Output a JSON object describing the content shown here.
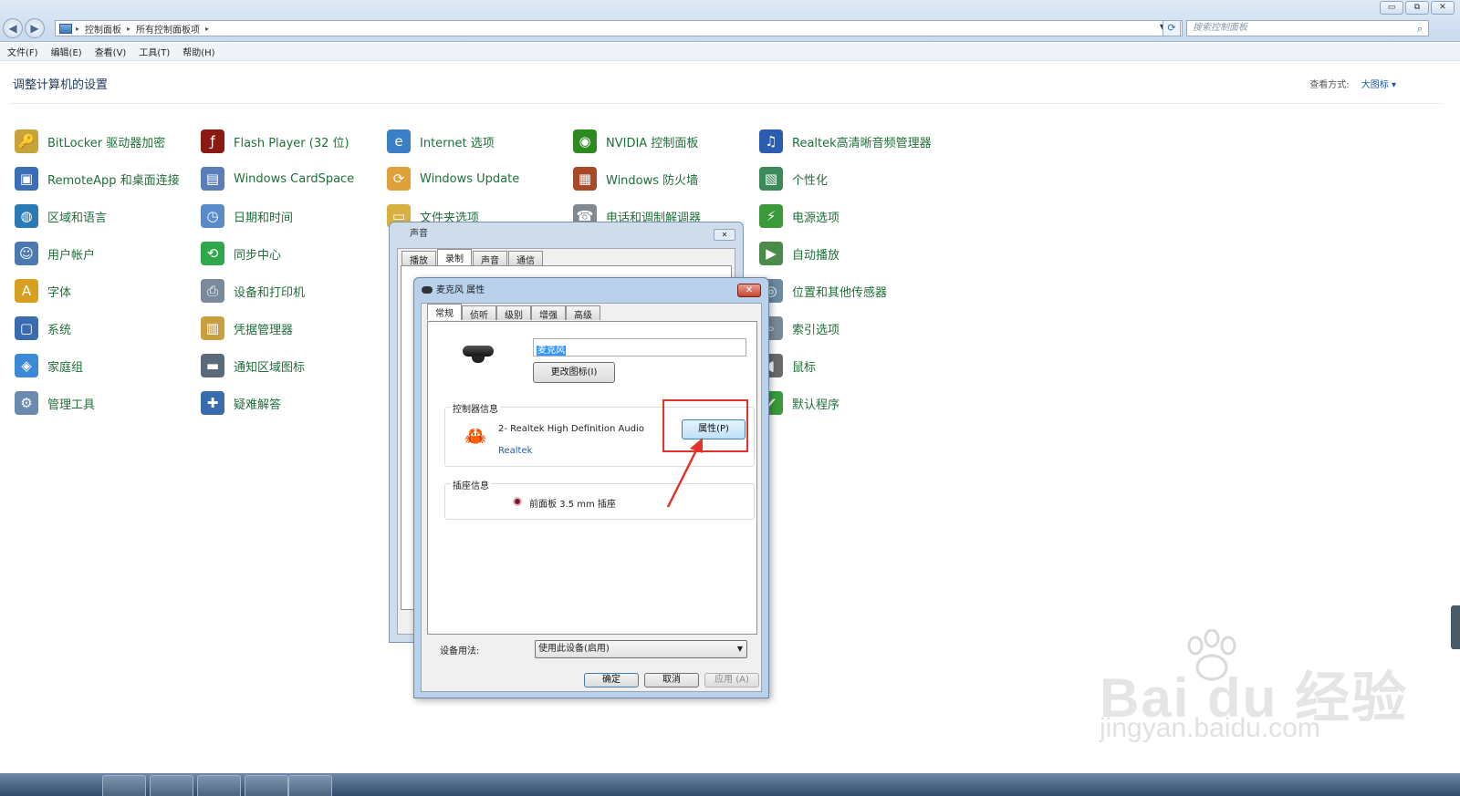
{
  "window": {
    "min_label": "▭",
    "restore_label": "⧉",
    "close_label": "✕"
  },
  "address": {
    "crumbs": [
      "控制面板",
      "所有控制面板项"
    ],
    "search_placeholder": "搜索控制面板"
  },
  "menu": [
    "文件(F)",
    "编辑(E)",
    "查看(V)",
    "工具(T)",
    "帮助(H)"
  ],
  "page": {
    "heading": "调整计算机的设置",
    "view_label": "查看方式:",
    "view_value": "大图标 ▾"
  },
  "items": [
    {
      "label": "BitLocker 驱动器加密",
      "icon": "bitlocker-icon",
      "color": "#c8a23a"
    },
    {
      "label": "Flash Player (32 位)",
      "icon": "flash-icon",
      "color": "#8b1a12"
    },
    {
      "label": "Internet 选项",
      "icon": "internet-icon",
      "color": "#3a7fc8"
    },
    {
      "label": "NVIDIA 控制面板",
      "icon": "nvidia-icon",
      "color": "#2c8a1f"
    },
    {
      "label": "Realtek高清晰音频管理器",
      "icon": "realtek-audio-icon",
      "color": "#2a5cb0"
    },
    {
      "label": "RemoteApp 和桌面连接",
      "icon": "remoteapp-icon",
      "color": "#3a6fb8"
    },
    {
      "label": "Windows CardSpace",
      "icon": "cardspace-icon",
      "color": "#5a7fb8"
    },
    {
      "label": "Windows Update",
      "icon": "windows-update-icon",
      "color": "#e0a13a"
    },
    {
      "label": "Windows 防火墙",
      "icon": "firewall-icon",
      "color": "#a84a2a"
    },
    {
      "label": "个性化",
      "icon": "personalize-icon",
      "color": "#3a8a5a"
    },
    {
      "label": "区域和语言",
      "icon": "region-icon",
      "color": "#2a7ab8"
    },
    {
      "label": "日期和时间",
      "icon": "datetime-icon",
      "color": "#5a8ac8"
    },
    {
      "label": "文件夹选项",
      "icon": "folder-options-icon",
      "color": "#d8b040"
    },
    {
      "label": "电话和调制解调器",
      "icon": "phone-icon",
      "color": "#808890"
    },
    {
      "label": "电源选项",
      "icon": "power-icon",
      "color": "#3a9a3a"
    },
    {
      "label": "用户帐户",
      "icon": "user-accounts-icon",
      "color": "#4a7ab0"
    },
    {
      "label": "同步中心",
      "icon": "sync-icon",
      "color": "#2ea84a"
    },
    {
      "label": "自动播放",
      "icon": "autoplay-icon",
      "color": "#4a8a4a"
    },
    {
      "label": "字体",
      "icon": "fonts-icon",
      "color": "#d8a020"
    },
    {
      "label": "设备和打印机",
      "icon": "printer-icon",
      "color": "#7a8a9a"
    },
    {
      "label": "位置和其他传感器",
      "icon": "sensor-icon",
      "color": "#6a8aa0"
    },
    {
      "label": "系统",
      "icon": "system-icon",
      "color": "#3a6ab0"
    },
    {
      "label": "凭据管理器",
      "icon": "credential-icon",
      "color": "#c8a040"
    },
    {
      "label": "索引选项",
      "icon": "index-icon",
      "color": "#7a8a9a"
    },
    {
      "label": "家庭组",
      "icon": "homegroup-icon",
      "color": "#3a8ad8"
    },
    {
      "label": "通知区域图标",
      "icon": "tray-icon",
      "color": "#5a6a7a"
    },
    {
      "label": "鼠标",
      "icon": "mouse-icon",
      "color": "#6a6a6a"
    },
    {
      "label": "管理工具",
      "icon": "admin-tools-icon",
      "color": "#6a8ab0"
    },
    {
      "label": "疑难解答",
      "icon": "troubleshoot-icon",
      "color": "#3a6ab0"
    },
    {
      "label": "默认程序",
      "icon": "default-programs-icon",
      "color": "#3a9a3a"
    }
  ],
  "sound_dialog": {
    "title": "声音",
    "tabs": [
      "播放",
      "录制",
      "声音",
      "通信"
    ],
    "active_tab": "录制"
  },
  "mic_dialog": {
    "title": "麦克风 属性",
    "tabs": [
      "常规",
      "侦听",
      "级别",
      "增强",
      "高级"
    ],
    "active_tab": "常规",
    "name_value": "麦克风",
    "change_icon_label": "更改图标(I)",
    "controller_legend": "控制器信息",
    "controller_name": "2- Realtek High Definition Audio",
    "controller_vendor": "Realtek",
    "properties_label": "属性(P)",
    "jack_legend": "插座信息",
    "jack_label": "前面板 3.5 mm 插座",
    "usage_label": "设备用法:",
    "usage_value": "使用此设备(启用)",
    "ok_label": "确定",
    "cancel_label": "取消",
    "apply_label": "应用 (A)"
  },
  "watermark": {
    "main": "Bai du 经验",
    "sub": "jingyan.baidu.com"
  },
  "colors": {
    "link_green": "#1f6f3a",
    "highlight_red": "#e5332a",
    "accent_blue": "#1e5aa8"
  }
}
